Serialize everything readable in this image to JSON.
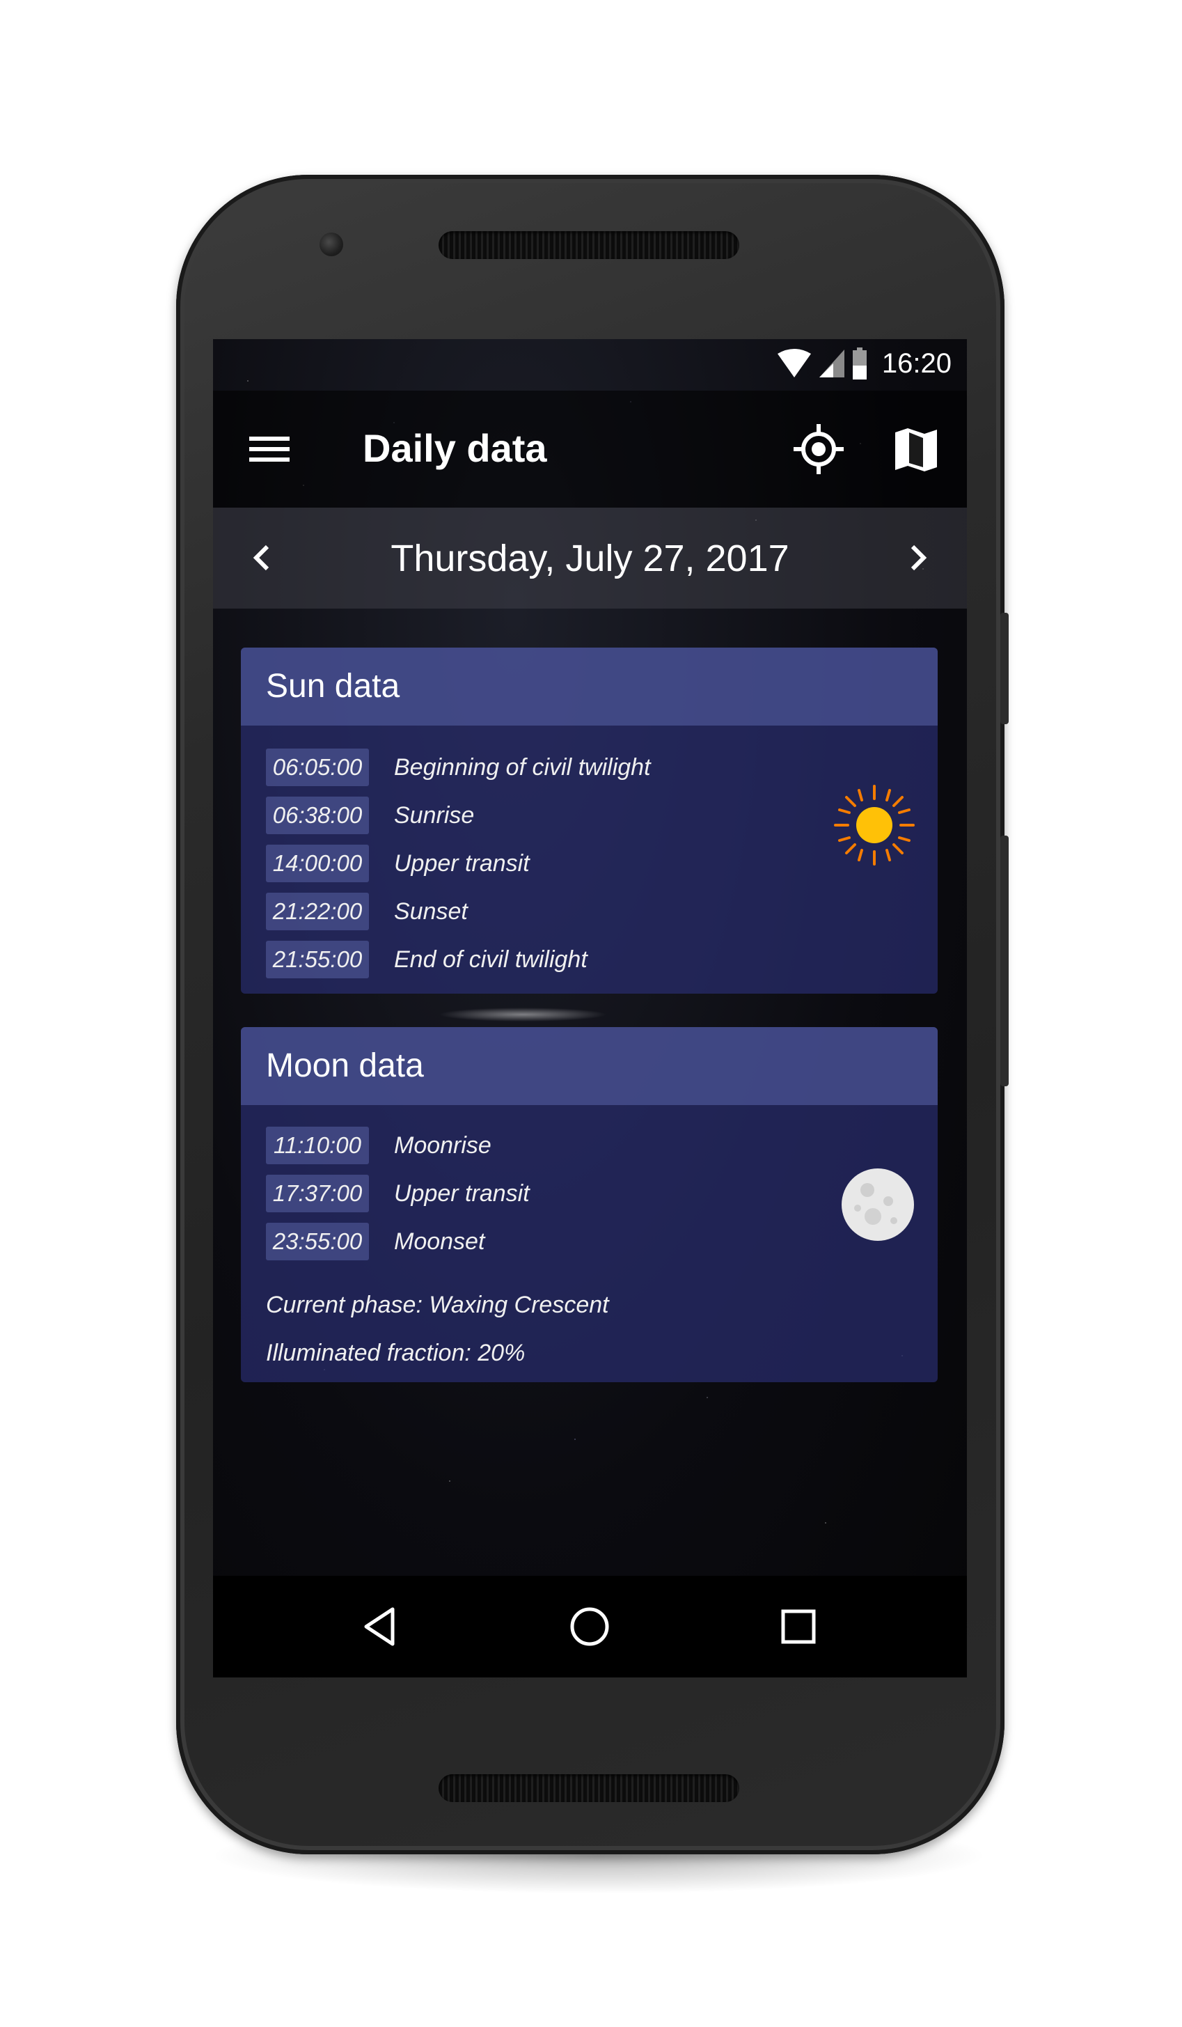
{
  "status_bar": {
    "time": "16:20",
    "icons": [
      "wifi-icon",
      "cell-signal-icon",
      "battery-icon"
    ]
  },
  "toolbar": {
    "title": "Daily data",
    "icons": [
      "menu-icon",
      "gps-icon",
      "map-icon"
    ]
  },
  "date_nav": {
    "date": "Thursday, July 27, 2017",
    "icons": [
      "chevron-left-icon",
      "chevron-right-icon"
    ]
  },
  "sun": {
    "title": "Sun data",
    "icon": "sun-icon",
    "events": [
      {
        "time": "06:05:00",
        "label": "Beginning of civil twilight"
      },
      {
        "time": "06:38:00",
        "label": "Sunrise"
      },
      {
        "time": "14:00:00",
        "label": "Upper transit"
      },
      {
        "time": "21:22:00",
        "label": "Sunset"
      },
      {
        "time": "21:55:00",
        "label": "End of civil twilight"
      }
    ]
  },
  "moon": {
    "title": "Moon data",
    "icon": "moon-icon",
    "events": [
      {
        "time": "11:10:00",
        "label": "Moonrise"
      },
      {
        "time": "17:37:00",
        "label": "Upper transit"
      },
      {
        "time": "23:55:00",
        "label": "Moonset"
      }
    ],
    "phase": "Current phase: Waxing Crescent",
    "illumination": "Illuminated fraction: 20%"
  },
  "nav_bar": {
    "icons": [
      "back-icon",
      "home-icon",
      "recents-icon"
    ]
  },
  "colors": {
    "card": "#282d6e",
    "card_header": "#5a64aa",
    "sun_yellow": "#ffc107",
    "sun_rays": "#f57c00",
    "moon": "#e8e8e8"
  }
}
